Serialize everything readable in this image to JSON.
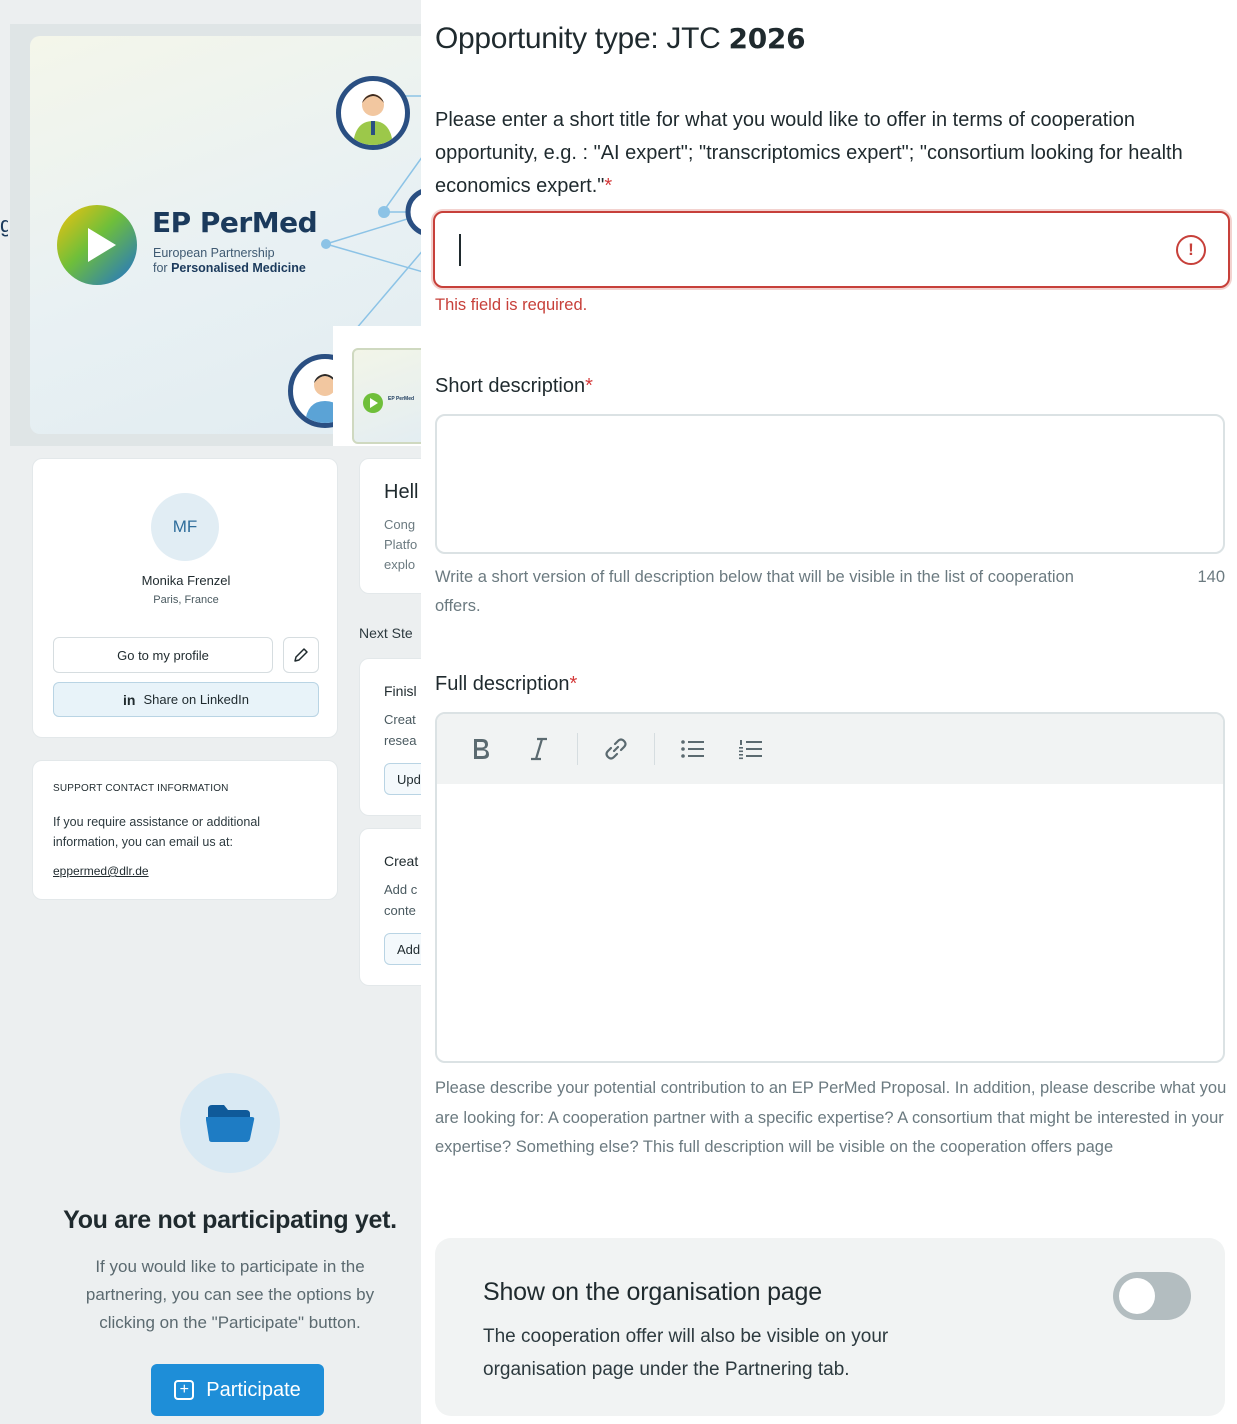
{
  "banner": {
    "brand_title": "EP PerMed",
    "brand_sub1": "European Partnership",
    "brand_sub2_prefix": "for ",
    "brand_sub2_bold": "Personalised Medicine",
    "thumb_label": "EP PerMed"
  },
  "profile": {
    "initials": "MF",
    "name": "Monika Frenzel",
    "location": "Paris, France",
    "go_profile_label": "Go to my profile",
    "linkedin_icon": "in",
    "linkedin_label": "Share on LinkedIn"
  },
  "support": {
    "heading": "SUPPORT CONTACT INFORMATION",
    "text": "If you require assistance or additional information, you can email us at:",
    "email": "eppermed@dlr.de"
  },
  "dashboard": {
    "hello": "Hell",
    "hello_lines": [
      "Cong",
      "Platfo",
      "explo"
    ],
    "next_steps": "Next Ste",
    "finish_title": "Finisl",
    "finish_lines": [
      "Creat",
      "resea"
    ],
    "finish_button": "Upd",
    "create_title": "Creat",
    "create_lines": [
      "Add c",
      "conte"
    ],
    "create_button": "Add"
  },
  "participation": {
    "title": "You are not participating yet.",
    "text": "If you would like to participate in the partnering, you can see the options by clicking on the \"Participate\" button.",
    "button_label": "Participate"
  },
  "form": {
    "opportunity_prefix": "Opportunity type: JTC ",
    "opportunity_year": "2026",
    "title_label": "Please enter a short title for what you would like to offer in terms of cooperation opportunity, e.g. : \"AI expert\"; \"transcriptomics expert\"; \"consortium looking for health economics expert.\"",
    "title_value": "",
    "required_mark": "*",
    "error_message": "This field is required.",
    "short_label": "Short description",
    "short_help": "Write a short version of full description below that will be visible in the list of cooperation offers.",
    "short_count": "140",
    "full_label": "Full description",
    "full_help": "Please describe your potential contribution to an EP PerMed Proposal. In addition, please describe what you are looking for: A cooperation partner with a specific expertise? A consortium that might be interested in your expertise? Something else? This full description will be visible on the cooperation offers page",
    "toolbar": [
      "bold-icon",
      "italic-icon",
      "link-icon",
      "bullet-list-icon",
      "numbered-list-icon"
    ],
    "show_title": "Show on the organisation page",
    "show_text": "The cooperation offer will also be visible on your organisation page under the Partnering tab.",
    "show_enabled": false
  },
  "colors": {
    "error": "#c7403a",
    "primary": "#1e8ed8",
    "brand_navy": "#1b3a5c"
  }
}
